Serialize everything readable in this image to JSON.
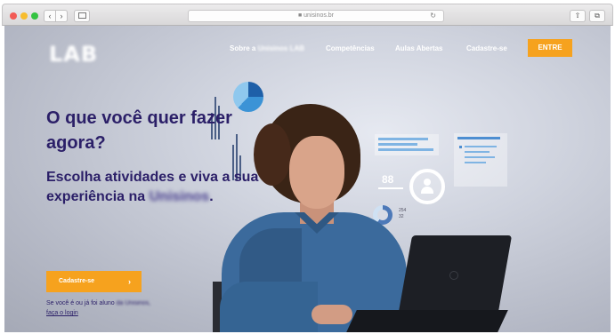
{
  "browser": {
    "address": "■ unisinos.br",
    "nav_back": "‹",
    "nav_forward": "›",
    "reload": "↻",
    "share": "⇧",
    "tabs": "⧉"
  },
  "site": {
    "logo": "LAB",
    "menu": {
      "item1_prefix": "Sobre a ",
      "item1_blurred": "Unisinos LAB",
      "item2": "Competências",
      "item3": "Aulas Abertas",
      "item4": "Cadastre-se"
    },
    "entre_button": "ENTRE"
  },
  "hero": {
    "headline": "O que você quer fazer agora?",
    "subhead_prefix": "Escolha atividades e viva a sua experiência na ",
    "subhead_blurred": "Unisinos",
    "subhead_suffix": ".",
    "cta_label": "Cadastre-se",
    "cta_arrow": "›",
    "login_prefix": "Se você é ou já foi aluno ",
    "login_blurred": "da Unisinos,",
    "login_link": "faça o login"
  },
  "graphics": {
    "num_88": "88",
    "small_numbers": [
      "254",
      "32"
    ]
  }
}
